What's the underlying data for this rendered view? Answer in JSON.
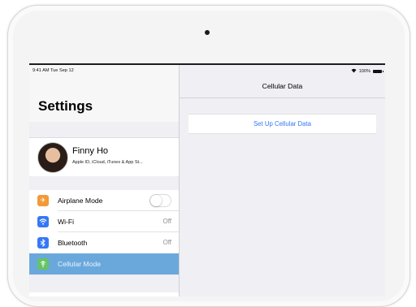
{
  "status_bar": {
    "time_date": "9:41 AM  Tue Sep 12",
    "battery": "100%"
  },
  "sidebar": {
    "title": "Settings",
    "profile": {
      "name": "Finny Ho",
      "subtitle": "Apple ID, iCloud, iTunes & App St..."
    },
    "items": [
      {
        "label": "Airplane Mode",
        "icon": "airplane-icon",
        "color": "#f19a37",
        "toggle": false
      },
      {
        "label": "Wi-Fi",
        "icon": "wifi-icon",
        "color": "#3478f6",
        "value": "Off"
      },
      {
        "label": "Bluetooth",
        "icon": "bluetooth-icon",
        "color": "#3478f6",
        "value": "Off"
      },
      {
        "label": "Cellular Mode",
        "icon": "cellular-icon",
        "color": "#65c466",
        "selected": true
      }
    ]
  },
  "detail": {
    "nav_title": "Cellular Data",
    "setup_button": "Set Up Cellular Data"
  },
  "colors": {
    "accent": "#3478f6",
    "selected_row": "#6aa8dc",
    "background": "#efeff4"
  }
}
